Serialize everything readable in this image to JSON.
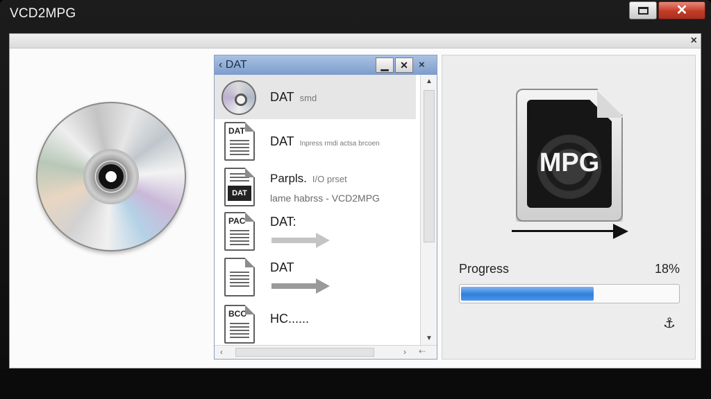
{
  "window": {
    "title": "VCD2MPG",
    "maximize_icon": "maximize-icon",
    "close_label": "✕",
    "client_close_label": "×"
  },
  "file_window": {
    "title": "‹ DAT",
    "minimize_label": "▁",
    "close_label": "✕",
    "close2_label": "×",
    "rows": [
      {
        "label": "DAT",
        "sub": "smd",
        "icon": "disc-icon"
      },
      {
        "label": "DAT",
        "sub": "Inpress rmdi actsa brcoen",
        "icon": "dat-file-icon",
        "tag": "DAT"
      },
      {
        "label": "Parpls.",
        "sub": "I/O  prset",
        "sub2": "lame habrss - VCD2MPG",
        "icon": "dat-dark-file-icon",
        "tag": "DAT"
      },
      {
        "label": "DAT:",
        "icon": "pac-file-icon",
        "tag": "PAC"
      },
      {
        "label": "DAT",
        "icon": "file-icon"
      },
      {
        "label": "HC......",
        "icon": "bcc-file-icon",
        "tag": "BCC"
      }
    ]
  },
  "converter": {
    "output_label": "MPG",
    "progress_label": "Progress",
    "progress_percent": "18%",
    "progress_value": 0.18,
    "anchor_icon": "⚓︎"
  },
  "colors": {
    "progress_fill": "#2f7fdc",
    "file_window_title": "#7c9ccc",
    "close_button": "#c23b26"
  }
}
